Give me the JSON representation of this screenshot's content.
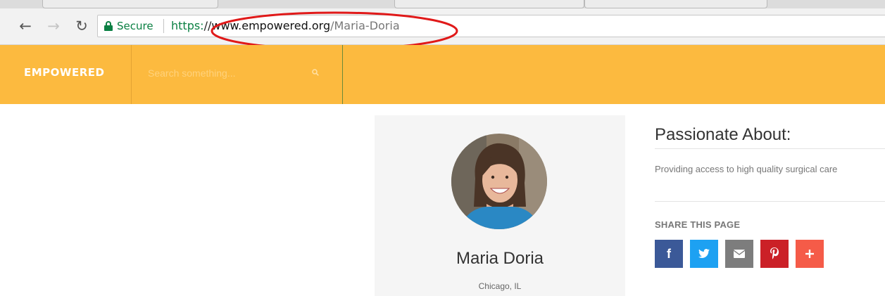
{
  "browser": {
    "nav": {
      "back_icon": "back-arrow-icon",
      "forward_icon": "forward-arrow-icon",
      "reload_icon": "reload-icon"
    },
    "address": {
      "secure_label": "Secure",
      "url_scheme": "https:",
      "url_slashes": "//",
      "url_host": "www.empowered.org",
      "url_path": "/Maria-Doria"
    }
  },
  "header": {
    "logo": "EMPOWERED",
    "search": {
      "placeholder": "Search something...",
      "icon": "search-icon"
    }
  },
  "profile": {
    "name": "Maria Doria",
    "location": "Chicago, IL"
  },
  "about": {
    "title": "Passionate About:",
    "text": "Providing access to high quality surgical care"
  },
  "share": {
    "label": "SHARE THIS PAGE",
    "buttons": [
      {
        "icon": "facebook-icon",
        "color": "#3b5998"
      },
      {
        "icon": "twitter-icon",
        "color": "#1da1f2"
      },
      {
        "icon": "email-icon",
        "color": "#7d7d7d"
      },
      {
        "icon": "pinterest-icon",
        "color": "#cb2027"
      },
      {
        "icon": "plus-icon",
        "color": "#f55b48"
      }
    ]
  },
  "colors": {
    "brand": "#fcba3f",
    "secure_green": "#0b8043",
    "annotation_red": "#e01919"
  }
}
